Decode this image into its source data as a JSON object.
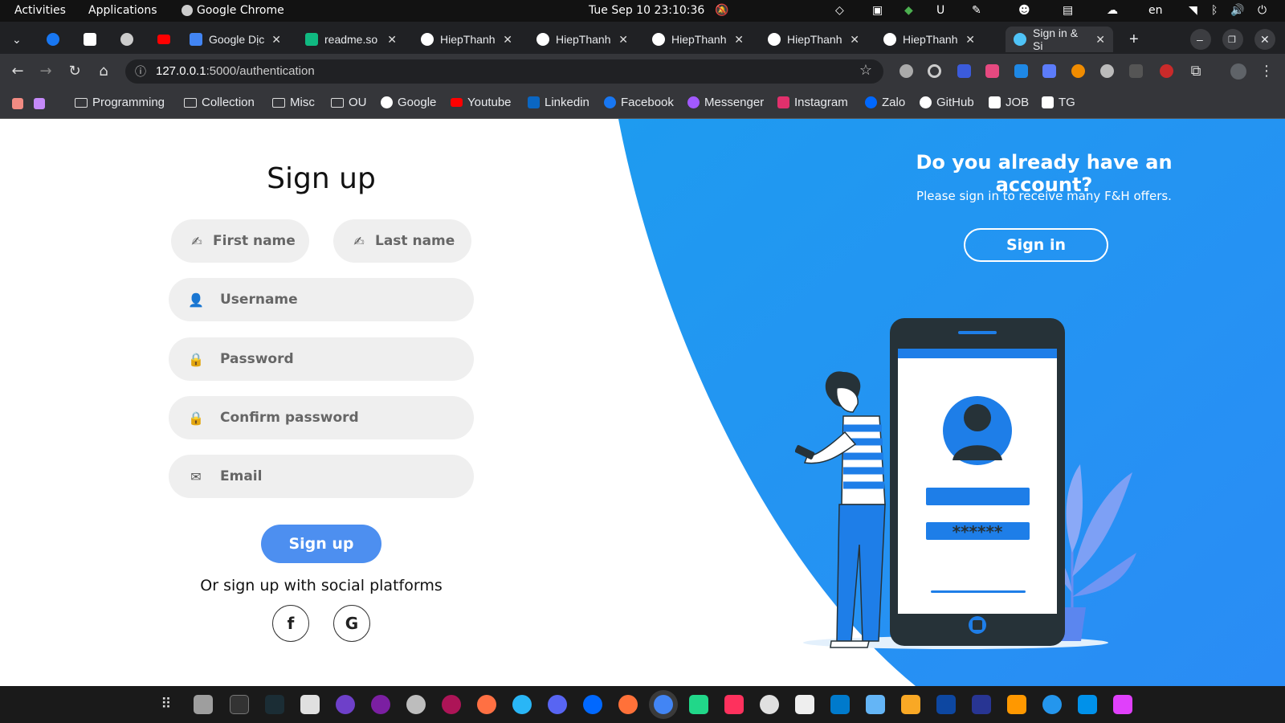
{
  "system_bar": {
    "activities": "Activities",
    "applications": "Applications",
    "app": "Google Chrome",
    "datetime": "Tue Sep 10  23:10:36",
    "lang": "en"
  },
  "tabs": [
    {
      "label": "",
      "icon": "facebook-icon",
      "color": "#1877f2"
    },
    {
      "label": "",
      "icon": "notion-icon",
      "color": "#ffffff"
    },
    {
      "label": "",
      "icon": "chatgpt-icon",
      "color": "#cccccc"
    },
    {
      "label": "",
      "icon": "youtube-icon",
      "color": "#ff0000"
    },
    {
      "label": "Google Dịc",
      "icon": "translate-icon",
      "color": "#4285f4"
    },
    {
      "label": "readme.so",
      "icon": "readme-icon",
      "color": "#10b981"
    },
    {
      "label": "HiepThanh",
      "icon": "github-icon",
      "color": "#ffffff"
    },
    {
      "label": "HiepThanh",
      "icon": "github-icon",
      "color": "#ffffff"
    },
    {
      "label": "HiepThanh",
      "icon": "github-icon",
      "color": "#ffffff"
    },
    {
      "label": "HiepThanh",
      "icon": "github-icon",
      "color": "#ffffff"
    },
    {
      "label": "HiepThanh",
      "icon": "github-icon",
      "color": "#ffffff"
    },
    {
      "label": "Sign in & Si",
      "icon": "stethoscope-icon",
      "color": "#4fc3f7"
    }
  ],
  "url": {
    "host": "127.0.0.1",
    "path": ":5000/authentication"
  },
  "bookmarks": [
    "Programming",
    "Collection",
    "Misc",
    "OU",
    "Google",
    "Youtube",
    "Linkedin",
    "Facebook",
    "Messenger",
    "Instagram",
    "Zalo",
    "GitHub",
    "JOB",
    "TG"
  ],
  "signup": {
    "title": "Sign up",
    "first_name": "First name",
    "last_name": "Last name",
    "username": "Username",
    "password": "Password",
    "confirm_password": "Confirm password",
    "email": "Email",
    "button": "Sign up",
    "alt_text": "Or sign up with social platforms",
    "facebook": "f",
    "google": "G"
  },
  "signin_panel": {
    "heading": "Do you already have an account?",
    "subtext": "Please sign in to receive many F&H offers.",
    "button": "Sign in",
    "password_mask": "******"
  },
  "colors": {
    "accent": "#2196f3",
    "button": "#4d8ff0",
    "phone": "#263238"
  }
}
